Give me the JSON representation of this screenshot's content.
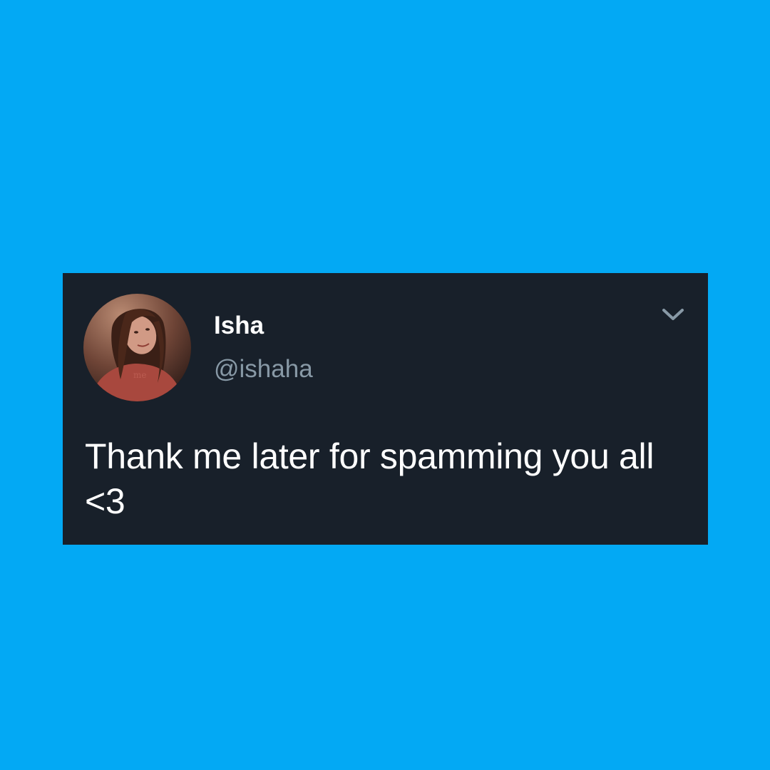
{
  "colors": {
    "background": "#03A9F4",
    "card": "#18202A",
    "name_text": "#FFFFFF",
    "handle_text": "#8899A6",
    "body_text": "#FFFFFF"
  },
  "tweet": {
    "author": {
      "display_name": "Isha",
      "handle": "@ishaha",
      "avatar_icon": "profile-photo"
    },
    "menu_icon": "chevron-down-icon",
    "text": "Thank me later for spamming you all <3"
  }
}
